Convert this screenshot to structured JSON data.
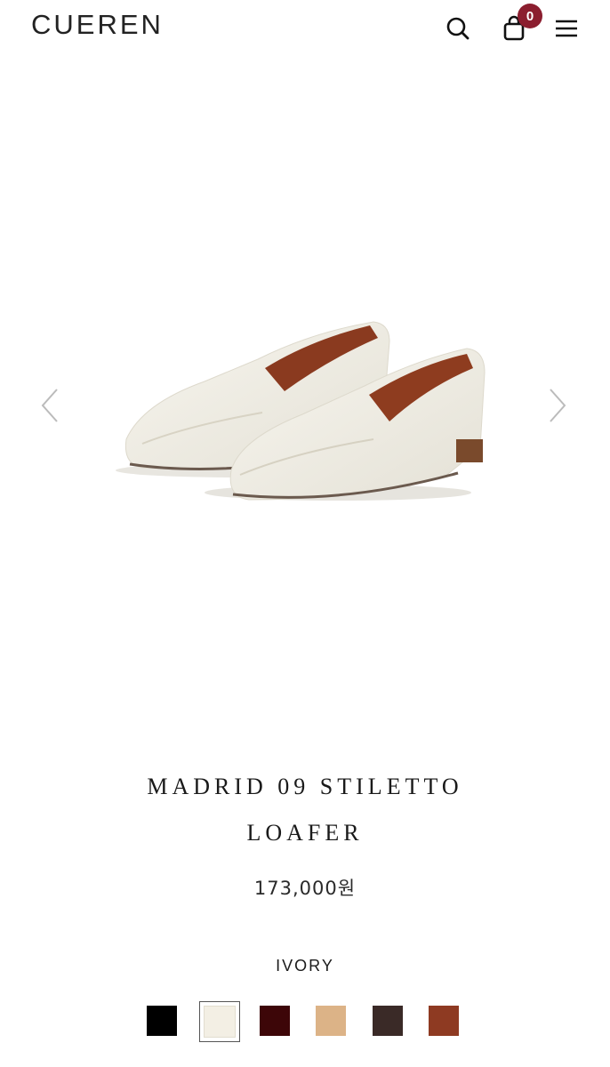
{
  "header": {
    "logo": "CUEREN",
    "cart_count": "0"
  },
  "product": {
    "title_line1": "MADRID 09 STILETTO",
    "title_line2": "LOAFER",
    "price": "173,000원",
    "selected_color": "IVORY",
    "colors": [
      {
        "hex": "#000000"
      },
      {
        "hex": "#f3efe4"
      },
      {
        "hex": "#3d0608"
      },
      {
        "hex": "#dcb387"
      },
      {
        "hex": "#3a2a27"
      },
      {
        "hex": "#8e3a22"
      }
    ]
  },
  "icons": {
    "search": "search-icon",
    "cart": "bag-icon",
    "menu": "hamburger-menu-icon",
    "prev": "chevron-left-icon",
    "next": "chevron-right-icon"
  },
  "colors": {
    "badge": "#8b1e2f",
    "text": "#1a1a1a"
  }
}
